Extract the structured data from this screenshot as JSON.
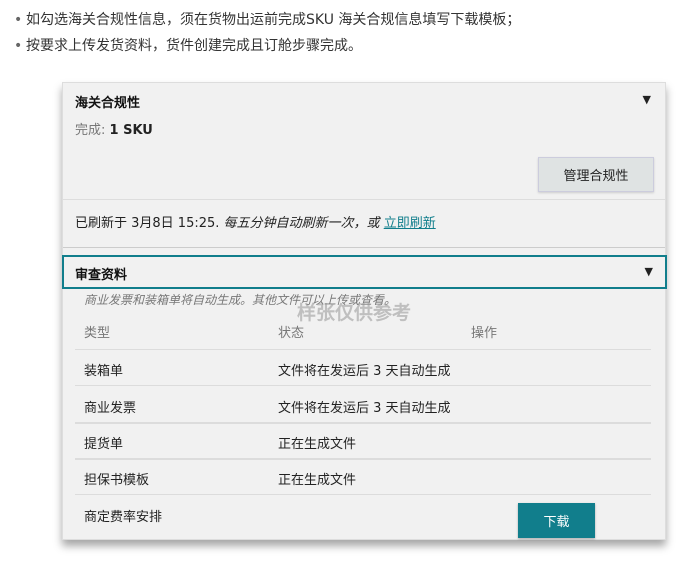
{
  "bullets": [
    "如勾选海关合规性信息，须在货物出运前完成SKU 海关合规信息填写下载模板；",
    "按要求上传发货资料，货件创建完成且订舱步骤完成。"
  ],
  "compliance": {
    "title": "海关合规性",
    "done_label": "完成:",
    "done_value": "1 SKU",
    "manage_button": "管理合规性"
  },
  "refresh": {
    "prefix": "已刷新于 3月8日 15:25.",
    "auto": "每五分钟自动刷新一次，或",
    "link": "立即刷新"
  },
  "review": {
    "title": "审查资料",
    "subtitle": "商业发票和装箱单将自动生成。其他文件可以上传或查看。",
    "watermark": "样张仅供参考",
    "columns": [
      "类型",
      "状态",
      "操作"
    ],
    "rows": [
      {
        "type": "装箱单",
        "status": "文件将在发运后 3 天自动生成"
      },
      {
        "type": "商业发票",
        "status": "文件将在发运后 3 天自动生成"
      },
      {
        "type": "提货单",
        "status": "正在生成文件"
      },
      {
        "type": "担保书模板",
        "status": "正在生成文件"
      },
      {
        "type": "商定费率安排",
        "status": ""
      }
    ],
    "download_button": "下载"
  }
}
